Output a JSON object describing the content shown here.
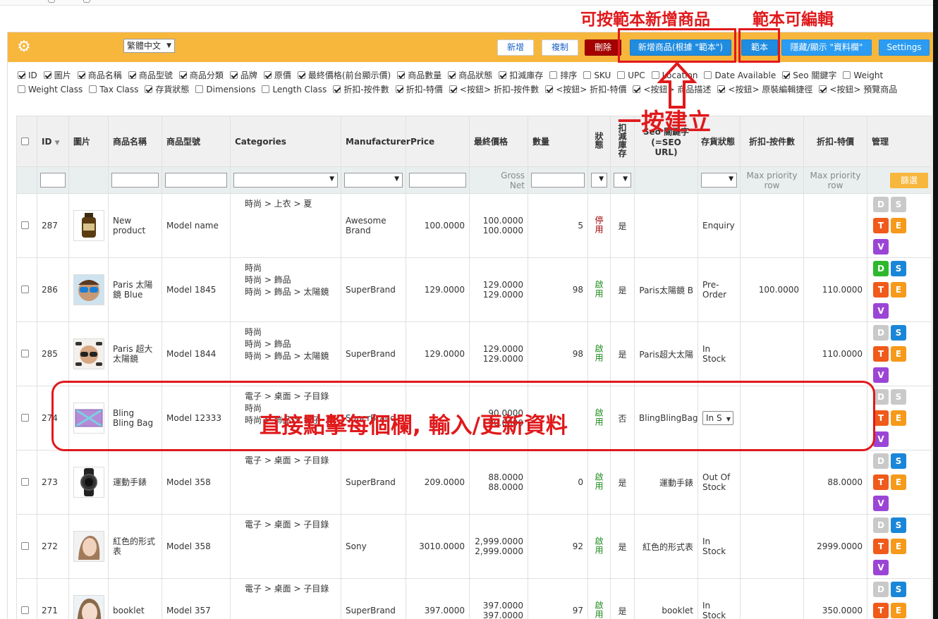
{
  "toolbar": {
    "language": "繁體中文",
    "buttons": {
      "add": "新增",
      "copy": "複制",
      "delete": "刪除",
      "add_by_template": "新增商品(根據 \"範本\")",
      "template": "範本",
      "toggle_columns": "隱藏/顯示 \"資料欄\"",
      "settings": "Settings"
    },
    "colors": {
      "bar": "#f7b63c",
      "delete": "#a50000",
      "blue": "#1f8ce0"
    }
  },
  "column_toggles": [
    {
      "label": "ID",
      "checked": true
    },
    {
      "label": "圖片",
      "checked": true
    },
    {
      "label": "商品名稱",
      "checked": true
    },
    {
      "label": "商品型號",
      "checked": true
    },
    {
      "label": "商品分類",
      "checked": true
    },
    {
      "label": "品牌",
      "checked": true
    },
    {
      "label": "原價",
      "checked": true
    },
    {
      "label": "最終價格(前台顯示價)",
      "checked": true
    },
    {
      "label": "商品數量",
      "checked": true
    },
    {
      "label": "商品狀態",
      "checked": true
    },
    {
      "label": "扣減庫存",
      "checked": true
    },
    {
      "label": "排序",
      "checked": false
    },
    {
      "label": "SKU",
      "checked": false
    },
    {
      "label": "UPC",
      "checked": false
    },
    {
      "label": "Location",
      "checked": false
    },
    {
      "label": "Date Available",
      "checked": false
    },
    {
      "label": "Seo 關鍵字",
      "checked": true
    },
    {
      "label": "Weight",
      "checked": false
    },
    {
      "label": "Weight Class",
      "checked": false
    },
    {
      "label": "Tax Class",
      "checked": false
    },
    {
      "label": "存貨狀態",
      "checked": true
    },
    {
      "label": "Dimensions",
      "checked": false
    },
    {
      "label": "Length Class",
      "checked": false
    },
    {
      "label": "折扣-按件數",
      "checked": true
    },
    {
      "label": "折扣-特價",
      "checked": true
    },
    {
      "label": "<按鈕> 折扣-按件數",
      "checked": true
    },
    {
      "label": "<按鈕> 折扣-特價",
      "checked": true
    },
    {
      "label": "<按鈕> 商品描述",
      "checked": true
    },
    {
      "label": "<按鈕> 原裝編輯捷徑",
      "checked": true
    },
    {
      "label": "<按鈕> 預覽商品",
      "checked": true
    }
  ],
  "table": {
    "headers": {
      "id": "ID",
      "image": "圖片",
      "name": "商品名稱",
      "model": "商品型號",
      "categories": "Categories",
      "manufacturer": "Manufacturer",
      "price": "Price",
      "final_price": "最終價格",
      "quantity": "數量",
      "status": "狀態",
      "subtract": "扣減庫存",
      "seo": "Seo 關鍵字 (=SEO URL)",
      "stock_status": "存貨狀態",
      "discount_qty": "折扣-按件數",
      "special": "折扣-特價",
      "manage": "管理"
    },
    "filter_row": {
      "gross": "Gross",
      "net": "Net",
      "max_priority": "Max priority row",
      "filter_button": "篩選"
    },
    "rows": [
      {
        "id": "287",
        "name": "New product",
        "model": "Model name",
        "categories": [
          "時尚 > 上衣 > 夏"
        ],
        "manufacturer": "Awesome Brand",
        "price": "100.0000",
        "gross": "100.0000",
        "net": "100.0000",
        "qty": "5",
        "qty_color": "orange",
        "status": "停用",
        "status_on": false,
        "subtract": "是",
        "seo": "",
        "stock": "Enquiry",
        "disc_qty": "",
        "special": "",
        "d_color": "gray",
        "s_color": "gray",
        "icon": "jar"
      },
      {
        "id": "286",
        "name": "Paris 太陽鏡 Blue",
        "model": "Model 1845",
        "categories": [
          "時尚",
          "時尚 > 飾品",
          "時尚 > 飾品 > 太陽鏡"
        ],
        "manufacturer": "SuperBrand",
        "price": "129.0000",
        "gross": "129.0000",
        "net": "129.0000",
        "qty": "98",
        "qty_color": "green",
        "status": "啟用",
        "status_on": true,
        "subtract": "是",
        "seo": "Paris太陽鏡 B",
        "stock": "Pre-Order",
        "disc_qty": "100.0000",
        "special": "110.0000",
        "d_color": "green",
        "s_color": "blue",
        "icon": "face"
      },
      {
        "id": "285",
        "name": "Paris 超大太陽鏡",
        "model": "Model 1844",
        "categories": [
          "時尚",
          "時尚 > 飾品",
          "時尚 > 飾品 > 太陽鏡"
        ],
        "manufacturer": "SuperBrand",
        "price": "129.0000",
        "gross": "129.0000",
        "net": "129.0000",
        "qty": "98",
        "qty_color": "green",
        "status": "啟用",
        "status_on": true,
        "subtract": "是",
        "seo": "Paris超大太陽",
        "stock": "In Stock",
        "disc_qty": "",
        "special": "110.0000",
        "d_color": "gray",
        "s_color": "blue",
        "icon": "glasses"
      },
      {
        "id": "274",
        "name": "Bling Bling Bag",
        "model": "Model 12333",
        "categories": [
          "電子 > 桌面 > 子目錄",
          "時尚",
          "時尚 > 飾品 > 袋子"
        ],
        "manufacturer": "SuperBrand",
        "price": "",
        "gross": "90.0000",
        "net": "90.0000",
        "qty": "",
        "qty_color": "green",
        "status": "啟用",
        "status_on": true,
        "subtract": "否",
        "seo": "BlingBlingBag",
        "stock": "In S",
        "stock_select": true,
        "disc_qty": "",
        "special": "",
        "d_color": "gray",
        "s_color": "gray",
        "icon": "bag"
      },
      {
        "id": "273",
        "name": "運動手錶",
        "model": "Model 358",
        "categories": [
          "電子 > 桌面 > 子目錄"
        ],
        "manufacturer": "SuperBrand",
        "price": "209.0000",
        "gross": "88.0000",
        "net": "88.0000",
        "qty": "0",
        "qty_color": "dark",
        "status": "啟用",
        "status_on": true,
        "subtract": "是",
        "seo": "運動手錶",
        "stock": "Out Of Stock",
        "disc_qty": "",
        "special": "88.0000",
        "d_color": "gray",
        "s_color": "blue",
        "icon": "watch"
      },
      {
        "id": "272",
        "name": "紅色的形式表",
        "model": "Model 358",
        "categories": [
          "電子 > 桌面 > 子目錄"
        ],
        "manufacturer": "Sony",
        "price": "3010.0000",
        "gross": "2,999.0000",
        "net": "2,999.0000",
        "qty": "92",
        "qty_color": "green",
        "status": "啟用",
        "status_on": true,
        "subtract": "是",
        "seo": "紅色的形式表",
        "stock": "In Stock",
        "disc_qty": "",
        "special": "2999.0000",
        "d_color": "gray",
        "s_color": "blue",
        "icon": "woman"
      },
      {
        "id": "271",
        "name": "booklet",
        "model": "Model 357",
        "categories": [
          "電子 > 桌面 > 子目錄"
        ],
        "manufacturer": "SuperBrand",
        "price": "397.0000",
        "gross": "397.0000",
        "net": "397.0000",
        "qty": "97",
        "qty_color": "green",
        "status": "啟用",
        "status_on": true,
        "subtract": "是",
        "seo": "booklet",
        "stock": "In Stock",
        "disc_qty": "",
        "special": "350.0000",
        "d_color": "gray",
        "s_color": "blue",
        "icon": "woman2"
      }
    ]
  },
  "annotations": {
    "add_by_template": "可按範本新增商品",
    "template_editable": "範本可編輯",
    "one_click": "一按建立",
    "inline_edit": "直接點擊每個欄, 輸入/更新資料"
  }
}
